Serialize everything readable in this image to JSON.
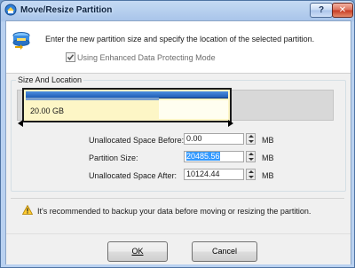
{
  "window": {
    "title": "Move/Resize Partition",
    "help_label": "?",
    "close_label": "✕"
  },
  "header": {
    "instruction": "Enter the new partition size and specify the location of the selected partition.",
    "checkbox_label": "Using Enhanced Data Protecting Mode",
    "checkbox_checked": true
  },
  "size_location": {
    "group_title": "Size And Location",
    "partition_size_label": "20.00 GB",
    "used_fraction": 0.66,
    "fields": [
      {
        "label": "Unallocated Space Before:",
        "value": "0.00",
        "unit": "MB"
      },
      {
        "label": "Partition Size:",
        "value": "20485.56",
        "unit": "MB"
      },
      {
        "label": "Unallocated Space After:",
        "value": "10124.44",
        "unit": "MB"
      }
    ]
  },
  "warning": {
    "text": "It's recommended to backup your data before moving or resizing the partition."
  },
  "buttons": {
    "ok": "OK",
    "cancel": "Cancel"
  },
  "colors": {
    "partition_bar": "#1f5db5",
    "partition_fill": "#fdf6c6",
    "selection": "#3399ff"
  }
}
